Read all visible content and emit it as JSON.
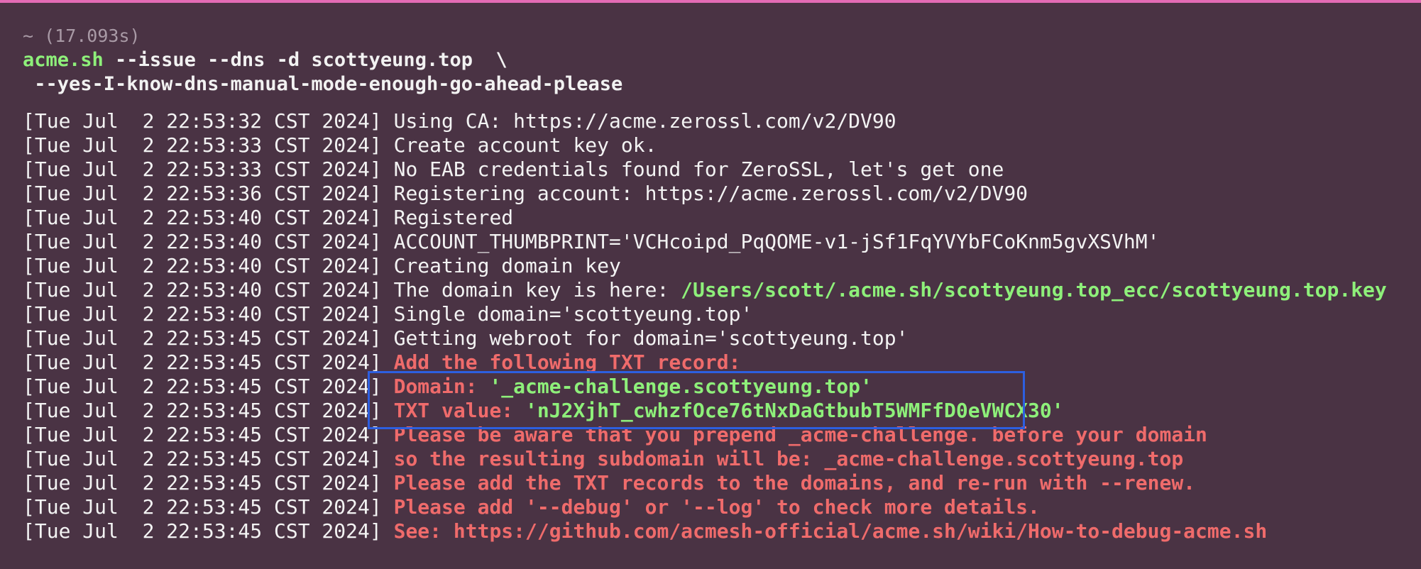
{
  "meta": {
    "duration": "~ (17.093s)"
  },
  "command": {
    "program": "acme.sh",
    "args_line1": " --issue --dns -d scottyeung.top  \\",
    "args_line2": " --yes-I-know-dns-manual-mode-enough-go-ahead-please"
  },
  "log": [
    {
      "ts": "[Tue Jul  2 22:53:32 CST 2024]",
      "parts": [
        {
          "style": "white",
          "text": " Using CA: https://acme.zerossl.com/v2/DV90"
        }
      ]
    },
    {
      "ts": "[Tue Jul  2 22:53:33 CST 2024]",
      "parts": [
        {
          "style": "white",
          "text": " Create account key ok."
        }
      ]
    },
    {
      "ts": "[Tue Jul  2 22:53:33 CST 2024]",
      "parts": [
        {
          "style": "white",
          "text": " No EAB credentials found for ZeroSSL, let's get one"
        }
      ]
    },
    {
      "ts": "[Tue Jul  2 22:53:36 CST 2024]",
      "parts": [
        {
          "style": "white",
          "text": " Registering account: https://acme.zerossl.com/v2/DV90"
        }
      ]
    },
    {
      "ts": "[Tue Jul  2 22:53:40 CST 2024]",
      "parts": [
        {
          "style": "white",
          "text": " Registered"
        }
      ]
    },
    {
      "ts": "[Tue Jul  2 22:53:40 CST 2024]",
      "parts": [
        {
          "style": "white",
          "text": " ACCOUNT_THUMBPRINT='VCHcoipd_PqQOME-v1-jSf1FqYVYbFCoKnm5gvXSVhM'"
        }
      ]
    },
    {
      "ts": "[Tue Jul  2 22:53:40 CST 2024]",
      "parts": [
        {
          "style": "white",
          "text": " Creating domain key"
        }
      ]
    },
    {
      "ts": "[Tue Jul  2 22:53:40 CST 2024]",
      "parts": [
        {
          "style": "white",
          "text": " The domain key is here: "
        },
        {
          "style": "green-b",
          "text": "/Users/scott/.acme.sh/scottyeung.top_ecc/scottyeung.top.key"
        }
      ]
    },
    {
      "ts": "[Tue Jul  2 22:53:40 CST 2024]",
      "parts": [
        {
          "style": "white",
          "text": " Single domain='scottyeung.top'"
        }
      ]
    },
    {
      "ts": "[Tue Jul  2 22:53:45 CST 2024]",
      "parts": [
        {
          "style": "white",
          "text": " Getting webroot for domain='scottyeung.top'"
        }
      ]
    },
    {
      "ts": "[Tue Jul  2 22:53:45 CST 2024]",
      "parts": [
        {
          "style": "red-b",
          "text": " Add the following TXT record:"
        }
      ]
    },
    {
      "ts": "[Tue Jul  2 22:53:45 CST 2024]",
      "parts": [
        {
          "style": "red-b",
          "text": " Domain: "
        },
        {
          "style": "green-b",
          "text": "'_acme-challenge.scottyeung.top'"
        }
      ]
    },
    {
      "ts": "[Tue Jul  2 22:53:45 CST 2024]",
      "parts": [
        {
          "style": "red-b",
          "text": " TXT value: "
        },
        {
          "style": "green-b",
          "text": "'nJ2XjhT_cwhzfOce76tNxDaGtbubT5WMFfD0eVWCX30'"
        }
      ]
    },
    {
      "ts": "[Tue Jul  2 22:53:45 CST 2024]",
      "parts": [
        {
          "style": "red-b",
          "text": " Please be aware that you prepend _acme-challenge. before your domain"
        }
      ]
    },
    {
      "ts": "[Tue Jul  2 22:53:45 CST 2024]",
      "parts": [
        {
          "style": "red-b",
          "text": " so the resulting subdomain will be: _acme-challenge.scottyeung.top"
        }
      ]
    },
    {
      "ts": "[Tue Jul  2 22:53:45 CST 2024]",
      "parts": [
        {
          "style": "red-b",
          "text": " Please add the TXT records to the domains, and re-run with --renew."
        }
      ]
    },
    {
      "ts": "[Tue Jul  2 22:53:45 CST 2024]",
      "parts": [
        {
          "style": "red-b",
          "text": " Please add '--debug' or '--log' to check more details."
        }
      ]
    },
    {
      "ts": "[Tue Jul  2 22:53:45 CST 2024]",
      "parts": [
        {
          "style": "red-b",
          "text": " See: https://github.com/acmesh-official/acme.sh/wiki/How-to-debug-acme.sh"
        }
      ]
    }
  ],
  "colors": {
    "background": "#4a3344",
    "top_border": "#e36bb4",
    "green": "#8ef07a",
    "red": "#ef6b6b",
    "highlight_box": "#2d5fe0"
  }
}
